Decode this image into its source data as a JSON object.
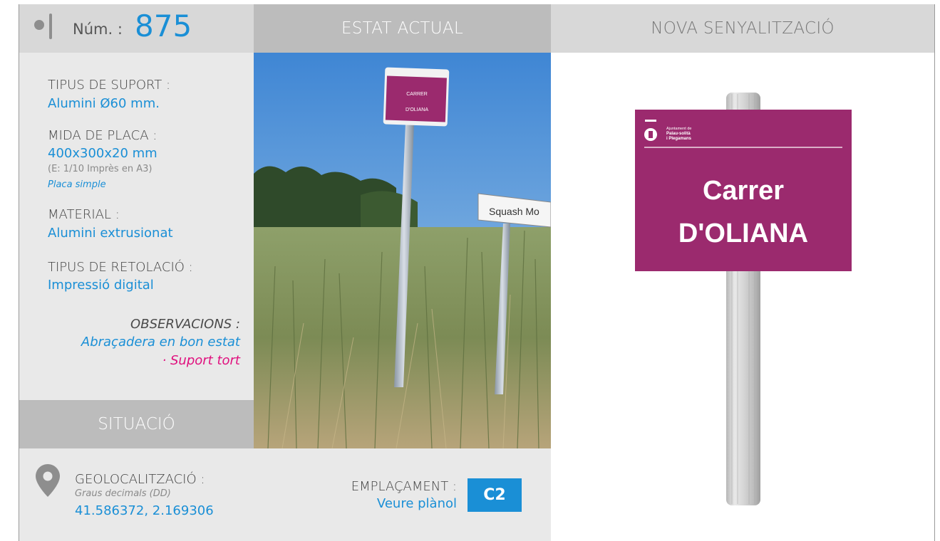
{
  "header": {
    "num_label": "Núm. :",
    "num_value": "875",
    "estat_title": "ESTAT ACTUAL",
    "nova_title": "NOVA SENYALITZACIÓ"
  },
  "info": {
    "suport_label": "TIPUS DE SUPORT :",
    "suport_value": "Alumini Ø60 mm.",
    "mida_label": "MIDA DE PLACA :",
    "mida_value": "400x300x20 mm",
    "mida_note": "(E: 1/10 Imprès en A3)",
    "mida_type": "Placa simple",
    "material_label": "MATERIAL :",
    "material_value": "Alumini extrusionat",
    "retolacio_label": "TIPUS DE RETOLACIÓ :",
    "retolacio_value": "Impressió digital",
    "observacions_label": "OBSERVACIONS :",
    "observacions_value": "Abraçadera en bon estat",
    "observacions_warning": "· Suport tort"
  },
  "situacio": {
    "title": "SITUACIÓ",
    "geo_label": "GEOLOCALITZACIÓ :",
    "geo_sub": "Graus decimals (DD)",
    "geo_value": "41.586372, 2.169306",
    "emplacament_label": "EMPLAÇAMENT :",
    "emplacament_value": "Veure plànol",
    "emplacament_code": "C2"
  },
  "photo": {
    "old_sign_line1": "CARRER",
    "old_sign_line2": "D'OLIANA",
    "other_sign": "Squash Mo"
  },
  "new_sign": {
    "org_line1": "Ajuntament de",
    "org_line2": "Palau-solità",
    "org_line3": "i Plegamans",
    "line1": "Carrer",
    "line2": "D'OLIANA",
    "color": "#9b2a6e"
  },
  "colors": {
    "accent": "#1a8fd6",
    "warning": "#e0107e",
    "header_dark": "#bcbcbc",
    "header_light": "#d8d8d8",
    "panel": "#e9e9e9"
  }
}
